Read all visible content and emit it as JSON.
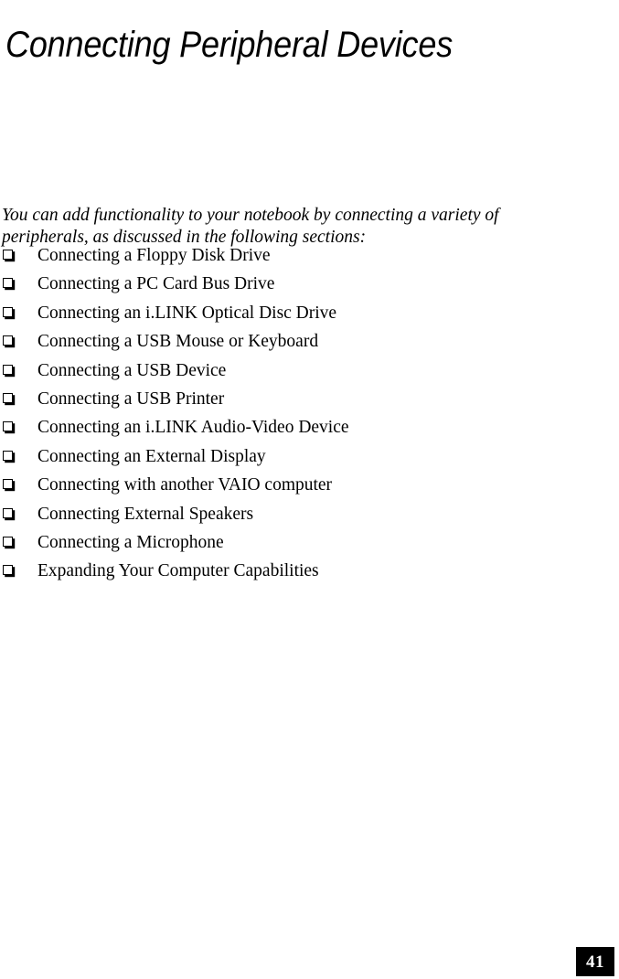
{
  "document": {
    "title": "Connecting Peripheral Devices",
    "intro": {
      "line1": "You can add functionality to your notebook by connecting a variety of",
      "line2": "peripherals, as discussed in the following sections:"
    },
    "toc": [
      {
        "label": "Connecting a Floppy Disk Drive"
      },
      {
        "label": "Connecting a PC Card Bus Drive"
      },
      {
        "label": "Connecting an i.LINK Optical Disc Drive"
      },
      {
        "label": "Connecting a USB Mouse or Keyboard"
      },
      {
        "label": "Connecting a USB Device"
      },
      {
        "label": "Connecting a USB Printer"
      },
      {
        "label": "Connecting an i.LINK Audio-Video Device"
      },
      {
        "label": "Connecting an External Display"
      },
      {
        "label": "Connecting with another VAIO computer"
      },
      {
        "label": "Connecting External Speakers"
      },
      {
        "label": "Connecting a Microphone"
      },
      {
        "label": "Expanding Your Computer Capabilities"
      }
    ],
    "footer": {
      "page_number": "41"
    },
    "colors": {
      "text": "#000000",
      "background": "#ffffff",
      "footer_background": "#000000",
      "footer_text": "#ffffff"
    },
    "bullet_icon": "hollow-square-shadow"
  }
}
